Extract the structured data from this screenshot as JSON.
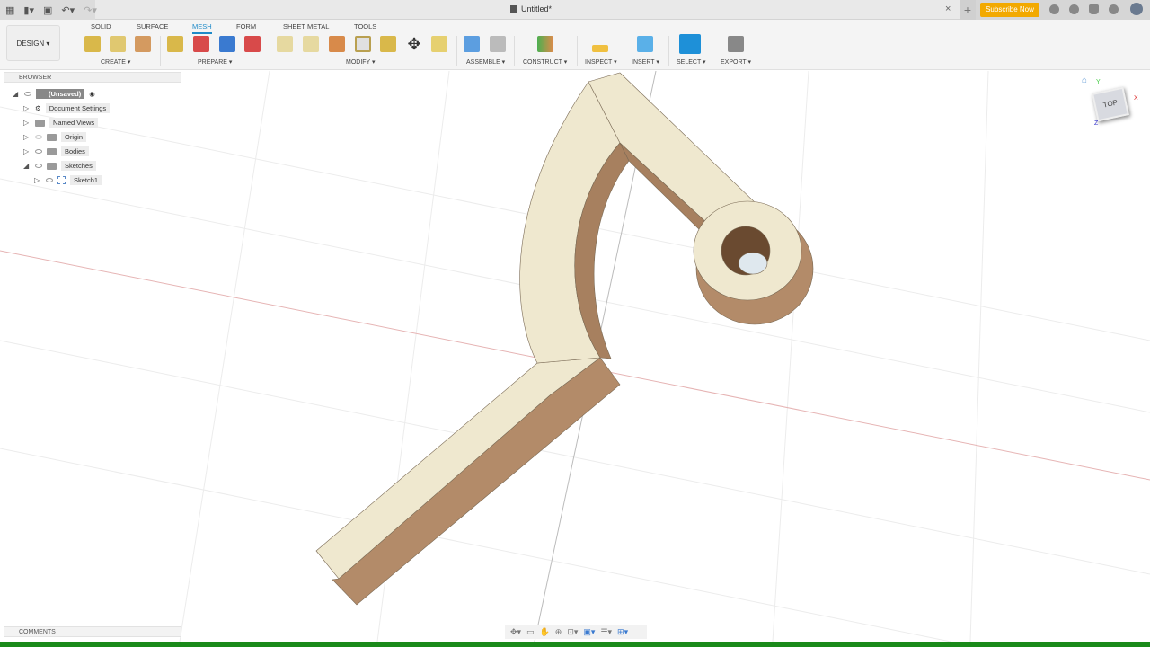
{
  "title_bar": {
    "document_title": "Untitled*",
    "subscribe_label": "Subscribe Now"
  },
  "toolbar": {
    "workspace": "DESIGN ▾",
    "tabs": [
      "SOLID",
      "SURFACE",
      "MESH",
      "FORM",
      "SHEET METAL",
      "TOOLS"
    ],
    "active_tab": "MESH",
    "groups": [
      "CREATE ▾",
      "PREPARE ▾",
      "MODIFY ▾",
      "ASSEMBLE ▾",
      "CONSTRUCT ▾",
      "INSPECT ▾",
      "INSERT ▾",
      "SELECT ▾",
      "EXPORT ▾"
    ]
  },
  "browser": {
    "header": "BROWSER",
    "items": [
      {
        "label": "(Unsaved)"
      },
      {
        "label": "Document Settings"
      },
      {
        "label": "Named Views"
      },
      {
        "label": "Origin"
      },
      {
        "label": "Bodies"
      },
      {
        "label": "Sketches"
      },
      {
        "label": "Sketch1"
      }
    ]
  },
  "comments": {
    "header": "COMMENTS"
  },
  "viewcube": {
    "face": "TOP",
    "axes": [
      "X",
      "Y",
      "Z"
    ]
  },
  "colors": {
    "accent": "#1e8ac8",
    "subscribe": "#f2a900",
    "mesh_top": "#efe8cf",
    "mesh_side": "#b38b69",
    "statusbar": "#1a8a1a"
  }
}
